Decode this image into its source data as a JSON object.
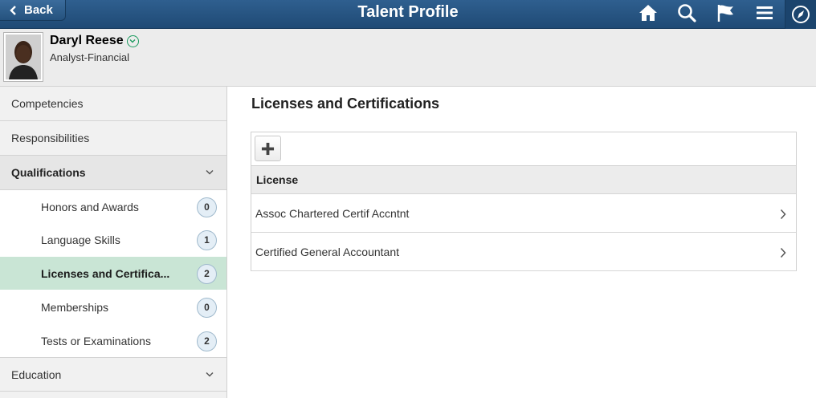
{
  "header": {
    "back_label": "Back",
    "title": "Talent Profile",
    "icons": [
      "home-icon",
      "search-icon",
      "flag-icon",
      "menu-icon",
      "compass-icon"
    ]
  },
  "profile": {
    "name": "Daryl Reese",
    "job_title": "Analyst-Financial"
  },
  "sidebar": {
    "items": [
      {
        "label": "Competencies"
      },
      {
        "label": "Responsibilities"
      },
      {
        "label": "Qualifications"
      },
      {
        "label": "Education"
      }
    ],
    "sub_items": [
      {
        "label": "Honors and Awards",
        "count": "0"
      },
      {
        "label": "Language Skills",
        "count": "1"
      },
      {
        "label": "Licenses and Certifica...",
        "count": "2"
      },
      {
        "label": "Memberships",
        "count": "0"
      },
      {
        "label": "Tests or Examinations",
        "count": "2"
      }
    ],
    "active_color": "#c9e5d5"
  },
  "main": {
    "title": "Licenses and Certifications",
    "column_header": "License",
    "rows": [
      {
        "label": "Assoc Chartered Certif Accntnt"
      },
      {
        "label": "Certified General Accountant"
      }
    ]
  },
  "colors": {
    "header_bg": "#2f5f8f",
    "accent_green": "#1a9a5e"
  }
}
